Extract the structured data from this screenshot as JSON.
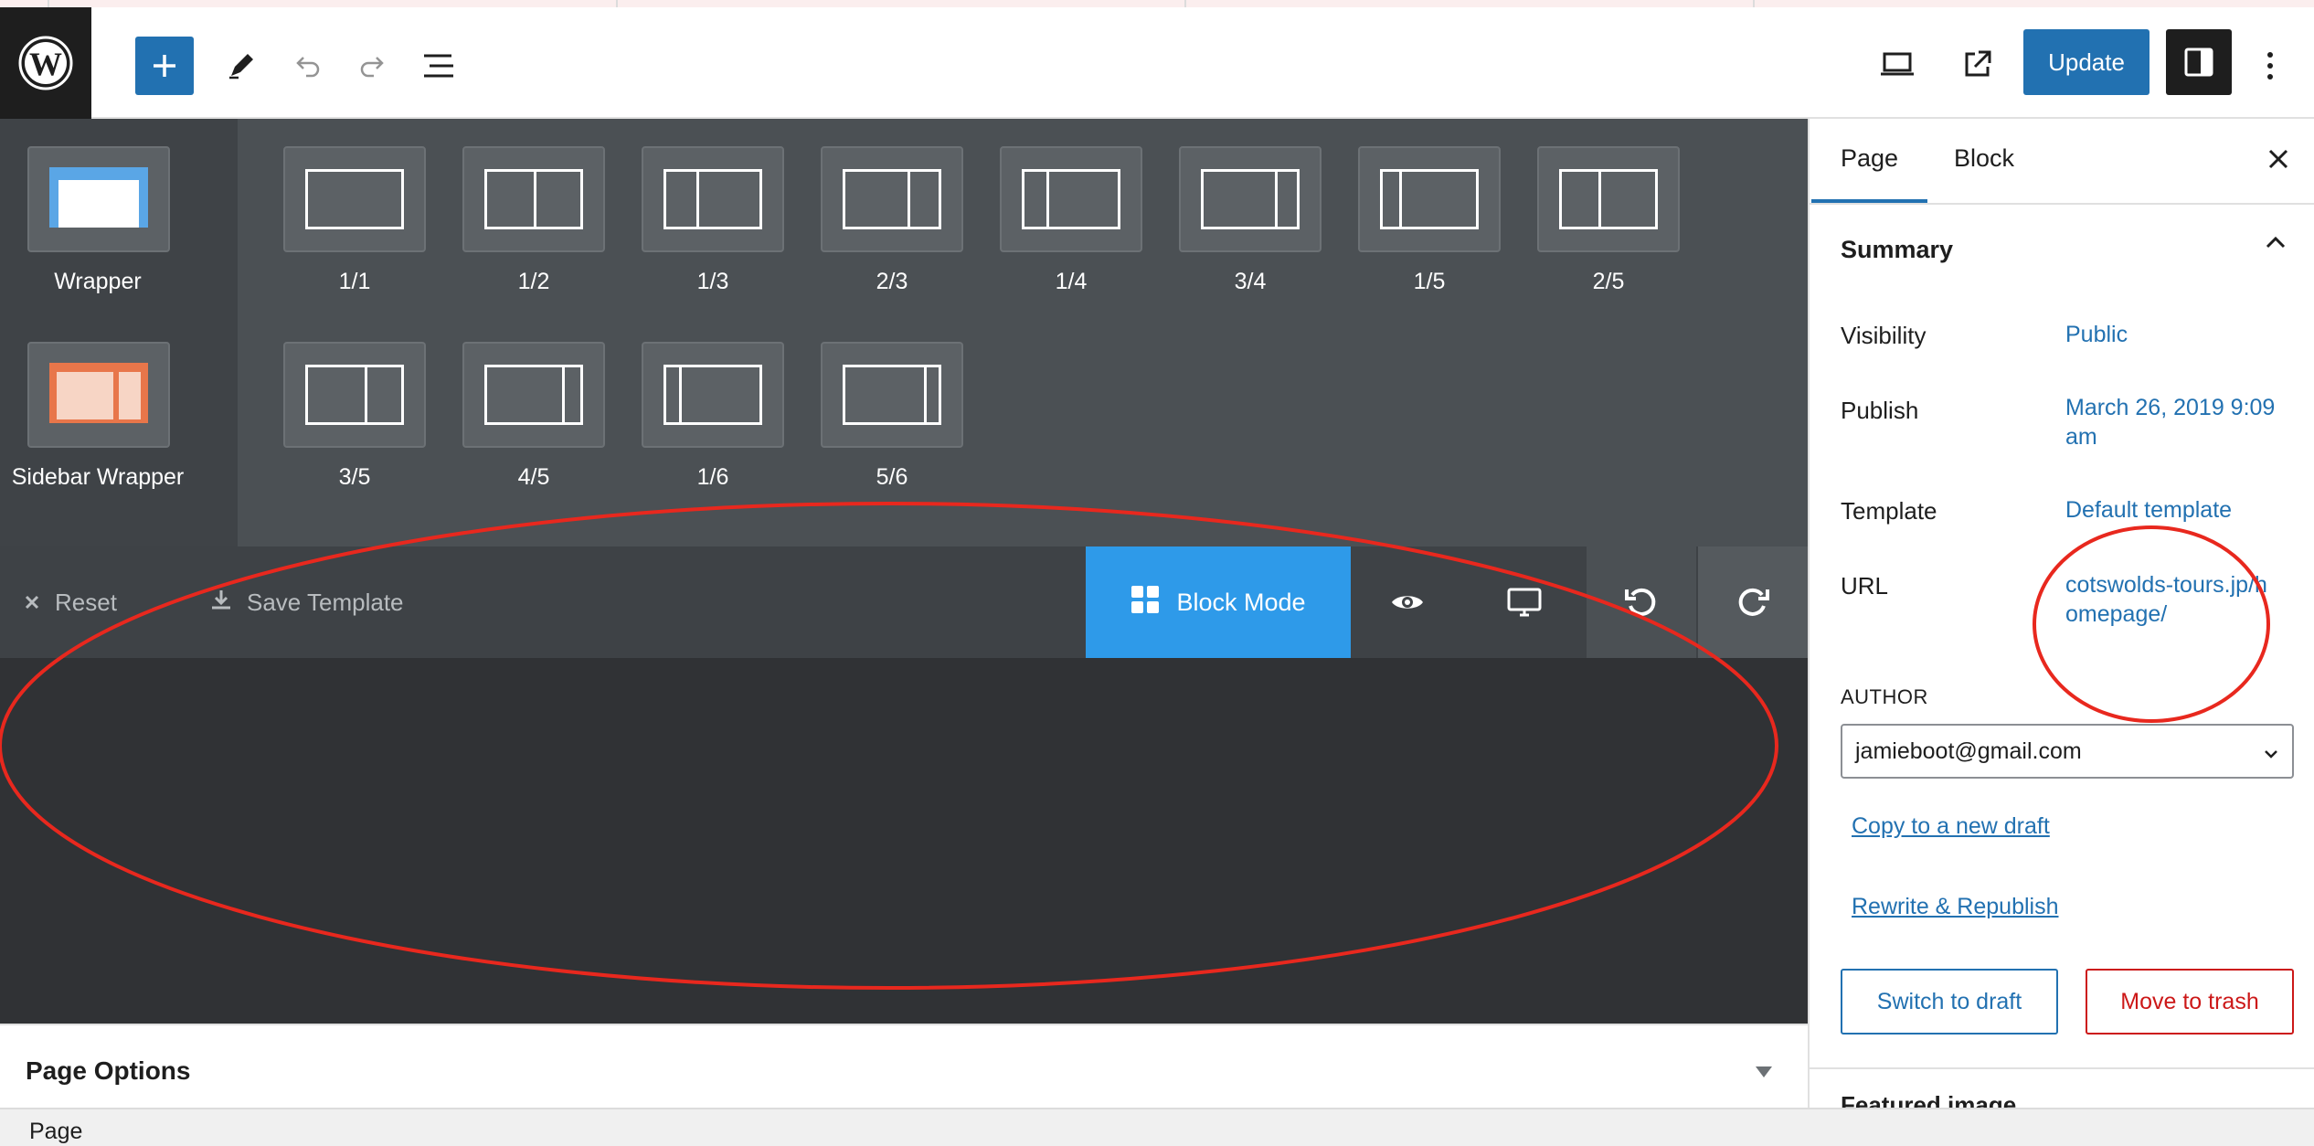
{
  "header": {
    "add_label": "+",
    "update_label": "Update"
  },
  "builder": {
    "wrappers": [
      {
        "label": "Wrapper",
        "icon": "wrapper-icon"
      },
      {
        "label": "Sidebar Wrapper",
        "icon": "sidebar-wrapper-icon"
      }
    ],
    "columns_row1": [
      "1/1",
      "1/2",
      "1/3",
      "2/3",
      "1/4",
      "3/4",
      "1/5",
      "2/5"
    ],
    "columns_row2": [
      "3/5",
      "4/5",
      "1/6",
      "5/6"
    ]
  },
  "toolbar": {
    "reset_label": "Reset",
    "save_template_label": "Save Template",
    "block_mode_label": "Block Mode"
  },
  "page_options": {
    "title": "Page Options"
  },
  "footer": {
    "breadcrumb": "Page"
  },
  "sidebar": {
    "tabs": [
      "Page",
      "Block"
    ],
    "summary_title": "Summary",
    "visibility_label": "Visibility",
    "visibility_value": "Public",
    "publish_label": "Publish",
    "publish_value": "March 26, 2019 9:09 am",
    "template_label": "Template",
    "template_value": "Default template",
    "url_label": "URL",
    "url_value": "cotswolds-tours.jp/homepage/",
    "author_label": "AUTHOR",
    "author_value": "jamieboot@gmail.com",
    "copy_draft_label": "Copy to a new draft",
    "rewrite_label": "Rewrite & Republish",
    "switch_draft_label": "Switch to draft",
    "move_trash_label": "Move to trash",
    "featured_label": "Featured image"
  },
  "colors": {
    "accent": "#2271b1",
    "block_mode": "#2e9ae9",
    "danger": "#cc1818",
    "annotation": "#e8281e"
  }
}
